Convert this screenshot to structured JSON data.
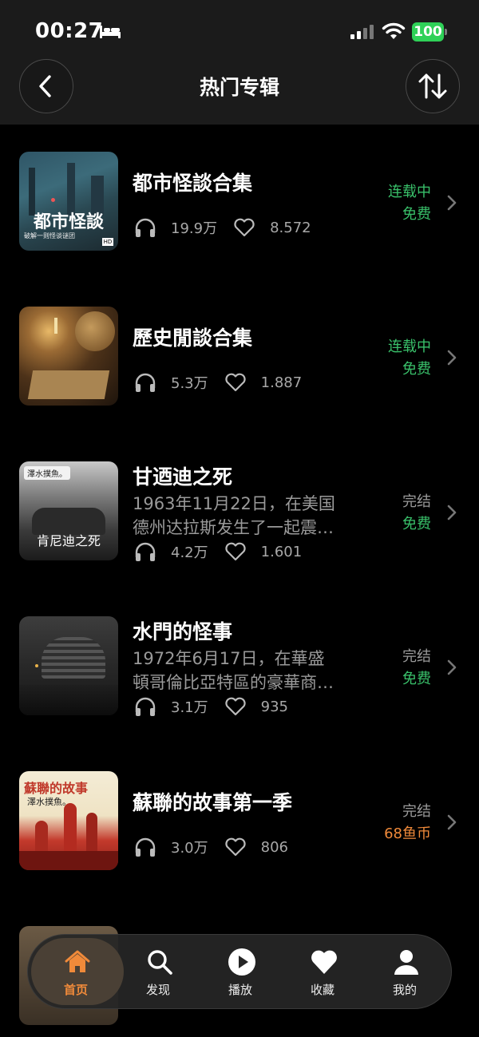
{
  "status_bar": {
    "time": "00:27",
    "battery": "100"
  },
  "header": {
    "title": "热门专辑"
  },
  "colors": {
    "ongoing": "#39c06a",
    "free": "#39c06a",
    "paid": "#f08a3a",
    "finished": "#9a9a9a",
    "battery": "#2fd158"
  },
  "albums": [
    {
      "title": "都市怪談合集",
      "cover_text": "都市怪談",
      "cover_sub": "破解一则怪谈谜团",
      "desc": [],
      "plays": "19.9万",
      "likes": "8.572",
      "status": "连载中",
      "price": "免费"
    },
    {
      "title": "歷史閒談合集",
      "desc": [],
      "plays": "5.3万",
      "likes": "1.887",
      "status": "连载中",
      "price": "免费"
    },
    {
      "title": "甘迺迪之死",
      "cover_text": "肯尼迪之死",
      "cover_badge": "澤水撲魚。",
      "desc": [
        "1963年11月22日，在美国",
        "德州达拉斯发生了一起震…"
      ],
      "plays": "4.2万",
      "likes": "1.601",
      "status": "完结",
      "price": "免费"
    },
    {
      "title": "水門的怪事",
      "desc": [
        "1972年6月17日，在華盛",
        "頓哥倫比亞特區的豪華商…"
      ],
      "plays": "3.1万",
      "likes": "935",
      "status": "完结",
      "price": "免费"
    },
    {
      "title": "蘇聯的故事第一季",
      "cover_text": "蘇聯的故事",
      "cover_badge": "澤水撲魚。",
      "desc": [],
      "plays": "3.0万",
      "likes": "806",
      "status": "完结",
      "price": "68鱼币"
    }
  ],
  "tabs": [
    {
      "label": "首页",
      "icon": "home-icon"
    },
    {
      "label": "发现",
      "icon": "search-icon"
    },
    {
      "label": "播放",
      "icon": "play-icon"
    },
    {
      "label": "收藏",
      "icon": "heart-icon"
    },
    {
      "label": "我的",
      "icon": "person-icon"
    }
  ]
}
